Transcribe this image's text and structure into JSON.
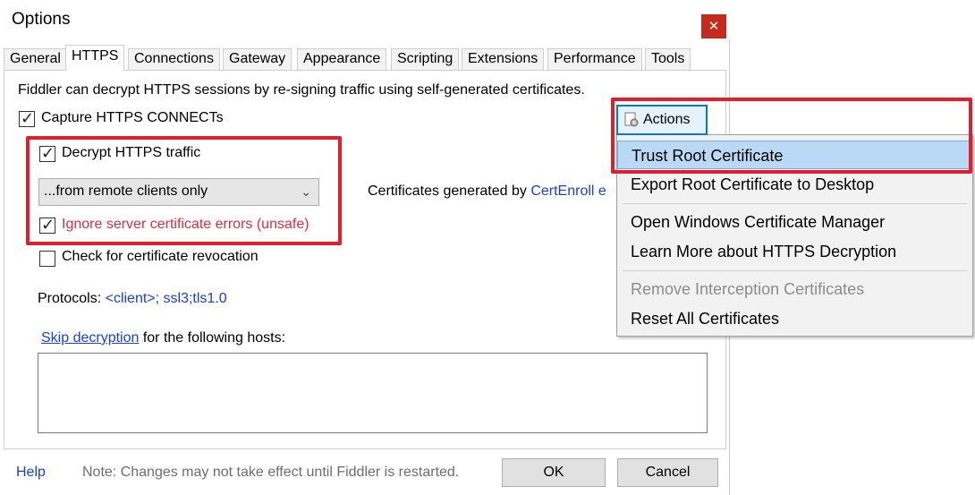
{
  "window": {
    "title": "Options",
    "close_glyph": "✕"
  },
  "tabs": [
    "General",
    "HTTPS",
    "Connections",
    "Gateway",
    "Appearance",
    "Scripting",
    "Extensions",
    "Performance",
    "Tools"
  ],
  "https": {
    "intro": "Fiddler can decrypt HTTPS sessions by re-signing traffic using self-generated certificates.",
    "capture_label": "Capture HTTPS CONNECTs",
    "decrypt_label": "Decrypt HTTPS traffic",
    "mode_value": "...from remote clients only",
    "ignore_label": "Ignore server certificate errors (unsafe)",
    "revocation_label": "Check for certificate revocation",
    "certs_prefix": "Certificates generated by",
    "certs_link": "CertEnroll e",
    "protocols_label": "Protocols:",
    "protocols_value": "<client>; ssl3;tls1.0",
    "skip_link": "Skip decryption",
    "skip_suffix": " for the following hosts:",
    "hosts_value": ""
  },
  "checkboxes": {
    "capture": true,
    "decrypt": true,
    "ignore": true,
    "revocation": false
  },
  "footer": {
    "help": "Help",
    "note": "Note: Changes may not take effect until Fiddler is restarted.",
    "ok": "OK",
    "cancel": "Cancel"
  },
  "actions": {
    "button_label": "Actions",
    "menu": [
      "Trust Root Certificate",
      "Export Root Certificate to Desktop",
      "Open Windows Certificate Manager",
      "Learn More about HTTPS Decryption",
      "Remove Interception Certificates",
      "Reset All Certificates"
    ]
  },
  "colors": {
    "highlight_red": "#e01e2c",
    "link_blue": "#1a3fd1",
    "close_red": "#c42b1c",
    "menu_highlight": "#b9d9f4"
  },
  "check_glyph": "✓"
}
